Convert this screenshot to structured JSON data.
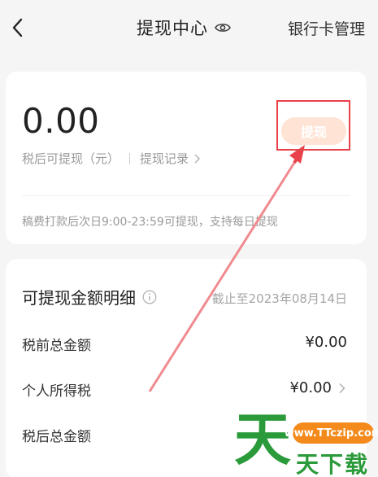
{
  "header": {
    "title": "提现中心",
    "bank_link": "银行卡管理"
  },
  "balance_card": {
    "amount": "0.00",
    "amount_label": "税后可提现（元）",
    "records_link": "提现记录",
    "withdraw_button": "提现",
    "notice": "稿费打款后次日9:00-23:59可提现，支持每日提现"
  },
  "detail": {
    "title": "可提现金额明细",
    "cutoff": "截止至2023年08月14日",
    "rows": [
      {
        "label": "税前总金额",
        "value": "¥0.00"
      },
      {
        "label": "个人所得税",
        "value": "¥0.00"
      },
      {
        "label": "税后总金额",
        "value": ""
      }
    ]
  },
  "watermark": {
    "glyph": "天",
    "url": "www.TTczip.com",
    "text": "天下载"
  },
  "colors": {
    "accent_button_bg": "#ffe3d4",
    "highlight": "#e8434a",
    "watermark_green": "#2a9a3a",
    "watermark_orange": "#f38a1b"
  }
}
